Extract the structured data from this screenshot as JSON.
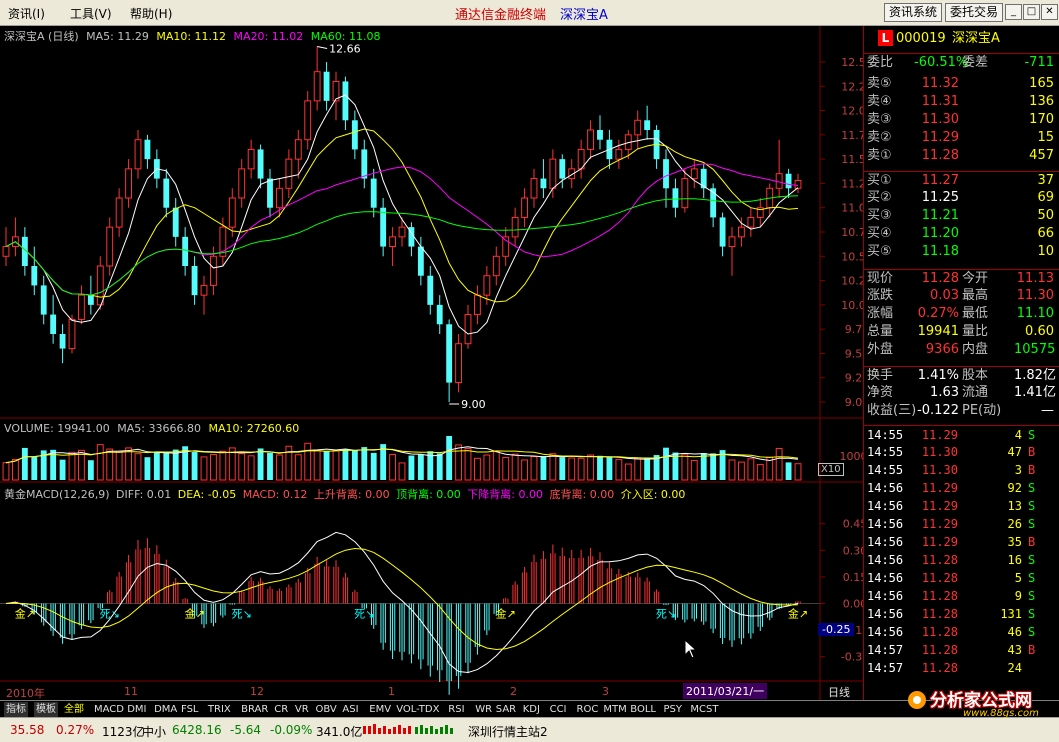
{
  "menubar": {
    "menu_info": "资讯(I)",
    "menu_tools": "工具(V)",
    "menu_help": "帮助(H)",
    "app_title": "通达信金融终端",
    "app_stock": "深深宝A",
    "btn_info_system": "资讯系统",
    "btn_trade": "委托交易"
  },
  "chart_data": [
    {
      "type": "candlestick",
      "title": "深深宝A (日线)",
      "indicators": [
        {
          "name": "MA5",
          "value": 11.29,
          "color": "#ffffff"
        },
        {
          "name": "MA10",
          "value": 11.12,
          "color": "#ffff00"
        },
        {
          "name": "MA20",
          "value": 11.02,
          "color": "#ff00ff"
        },
        {
          "name": "MA60",
          "value": 11.08,
          "color": "#00ff00"
        }
      ],
      "ylim": [
        9.0,
        12.5
      ],
      "yticks": [
        "12.50",
        "12.25",
        "12.00",
        "11.75",
        "11.50",
        "11.25",
        "11.00",
        "10.75",
        "10.50",
        "10.25",
        "10.00",
        "9.75",
        "9.50",
        "9.25",
        "9.00"
      ],
      "annotations": [
        {
          "label": "12.66"
        },
        {
          "label": "9.00"
        }
      ],
      "x_labels": [
        "2010年",
        "11",
        "12",
        "1",
        "2",
        "3"
      ],
      "date_label": "2011/03/21/一",
      "period": "日线",
      "ohlc": [
        [
          10.5,
          10.8,
          10.4,
          10.6
        ],
        [
          10.6,
          10.9,
          10.5,
          10.7
        ],
        [
          10.7,
          10.8,
          10.3,
          10.4
        ],
        [
          10.4,
          10.6,
          10.1,
          10.2
        ],
        [
          10.2,
          10.3,
          9.8,
          9.9
        ],
        [
          9.9,
          10.1,
          9.6,
          9.7
        ],
        [
          9.7,
          9.8,
          9.4,
          9.55
        ],
        [
          9.55,
          9.9,
          9.5,
          9.85
        ],
        [
          9.85,
          10.2,
          9.8,
          10.1
        ],
        [
          10.1,
          10.3,
          9.9,
          10.0
        ],
        [
          10.0,
          10.5,
          9.95,
          10.4
        ],
        [
          10.4,
          10.9,
          10.3,
          10.8
        ],
        [
          10.8,
          11.2,
          10.7,
          11.1
        ],
        [
          11.1,
          11.5,
          11.0,
          11.4
        ],
        [
          11.4,
          11.8,
          11.3,
          11.7
        ],
        [
          11.7,
          11.75,
          11.4,
          11.5
        ],
        [
          11.5,
          11.6,
          11.2,
          11.3
        ],
        [
          11.3,
          11.4,
          10.9,
          11.0
        ],
        [
          11.0,
          11.1,
          10.6,
          10.7
        ],
        [
          10.7,
          10.8,
          10.3,
          10.4
        ],
        [
          10.4,
          10.5,
          10.0,
          10.1
        ],
        [
          10.1,
          10.3,
          9.9,
          10.2
        ],
        [
          10.2,
          10.6,
          10.1,
          10.5
        ],
        [
          10.5,
          10.9,
          10.4,
          10.8
        ],
        [
          10.8,
          11.2,
          10.7,
          11.1
        ],
        [
          11.1,
          11.5,
          11.0,
          11.4
        ],
        [
          11.4,
          11.7,
          11.3,
          11.6
        ],
        [
          11.6,
          11.65,
          11.2,
          11.3
        ],
        [
          11.3,
          11.4,
          10.9,
          11.0
        ],
        [
          11.0,
          11.3,
          10.9,
          11.2
        ],
        [
          11.2,
          11.6,
          11.1,
          11.5
        ],
        [
          11.5,
          11.8,
          11.3,
          11.7
        ],
        [
          11.7,
          12.2,
          11.6,
          12.1
        ],
        [
          12.1,
          12.66,
          12.0,
          12.4
        ],
        [
          12.4,
          12.5,
          12.0,
          12.1
        ],
        [
          12.1,
          12.4,
          11.9,
          12.3
        ],
        [
          12.3,
          12.35,
          11.8,
          11.9
        ],
        [
          11.9,
          12.0,
          11.5,
          11.6
        ],
        [
          11.6,
          11.7,
          11.2,
          11.3
        ],
        [
          11.3,
          11.4,
          10.9,
          11.0
        ],
        [
          11.0,
          11.1,
          10.5,
          10.6
        ],
        [
          10.6,
          10.8,
          10.4,
          10.7
        ],
        [
          10.7,
          10.9,
          10.6,
          10.8
        ],
        [
          10.8,
          10.85,
          10.5,
          10.6
        ],
        [
          10.6,
          10.7,
          10.2,
          10.3
        ],
        [
          10.3,
          10.4,
          9.9,
          10.0
        ],
        [
          10.0,
          10.1,
          9.7,
          9.8
        ],
        [
          9.8,
          9.85,
          9.0,
          9.2
        ],
        [
          9.2,
          9.7,
          9.1,
          9.6
        ],
        [
          9.6,
          10.0,
          9.55,
          9.9
        ],
        [
          9.9,
          10.2,
          9.8,
          10.1
        ],
        [
          10.1,
          10.4,
          10.0,
          10.3
        ],
        [
          10.3,
          10.6,
          10.2,
          10.5
        ],
        [
          10.5,
          10.8,
          10.4,
          10.7
        ],
        [
          10.7,
          11.0,
          10.6,
          10.9
        ],
        [
          10.9,
          11.2,
          10.8,
          11.1
        ],
        [
          11.1,
          11.4,
          11.0,
          11.3
        ],
        [
          11.3,
          11.5,
          11.1,
          11.2
        ],
        [
          11.2,
          11.6,
          11.1,
          11.5
        ],
        [
          11.5,
          11.55,
          11.2,
          11.3
        ],
        [
          11.3,
          11.5,
          11.2,
          11.4
        ],
        [
          11.4,
          11.7,
          11.3,
          11.6
        ],
        [
          11.6,
          11.9,
          11.5,
          11.8
        ],
        [
          11.8,
          11.95,
          11.6,
          11.7
        ],
        [
          11.7,
          11.8,
          11.4,
          11.5
        ],
        [
          11.5,
          11.7,
          11.4,
          11.6
        ],
        [
          11.6,
          11.8,
          11.5,
          11.75
        ],
        [
          11.75,
          12.0,
          11.6,
          11.9
        ],
        [
          11.9,
          12.05,
          11.7,
          11.8
        ],
        [
          11.8,
          11.85,
          11.4,
          11.5
        ],
        [
          11.5,
          11.6,
          11.0,
          11.2
        ],
        [
          11.2,
          11.3,
          10.9,
          11.0
        ],
        [
          11.0,
          11.4,
          10.95,
          11.3
        ],
        [
          11.3,
          11.5,
          11.2,
          11.4
        ],
        [
          11.4,
          11.45,
          11.1,
          11.2
        ],
        [
          11.2,
          11.25,
          10.8,
          10.9
        ],
        [
          10.9,
          10.95,
          10.5,
          10.6
        ],
        [
          10.6,
          10.8,
          10.3,
          10.7
        ],
        [
          10.7,
          10.9,
          10.6,
          10.8
        ],
        [
          10.8,
          11.0,
          10.7,
          10.9
        ],
        [
          10.9,
          11.1,
          10.8,
          11.0
        ],
        [
          11.0,
          11.25,
          10.9,
          11.2
        ],
        [
          11.2,
          11.7,
          11.1,
          11.35
        ],
        [
          11.35,
          11.4,
          11.1,
          11.2
        ],
        [
          11.2,
          11.35,
          11.15,
          11.28
        ]
      ]
    },
    {
      "type": "bar",
      "title": "VOLUME",
      "indicators": [
        {
          "name": "VOLUME",
          "value": "19941.00",
          "color": "#c0c0c0"
        },
        {
          "name": "MA5",
          "value": "33666.80",
          "color": "#c0c0c0"
        },
        {
          "name": "MA10",
          "value": "27260.60",
          "color": "#ffff00"
        }
      ],
      "yticks": [
        "10000"
      ],
      "unit_label": "X10"
    },
    {
      "type": "bar",
      "title": "黄金MACD(12,26,9)",
      "indicators": [
        {
          "name": "DIFF",
          "value": "0.01",
          "color": "#c0c0c0"
        },
        {
          "name": "DEA",
          "value": "-0.05",
          "color": "#ffff00"
        },
        {
          "name": "MACD",
          "value": "0.12",
          "color": "#ff5050"
        },
        {
          "name": "上升背离",
          "value": "0.00",
          "color": "#ff5050"
        },
        {
          "name": "顶背离",
          "value": "0.00",
          "color": "#00ff00"
        },
        {
          "name": "下降背离",
          "value": "0.00",
          "color": "#ff00ff"
        },
        {
          "name": "底背离",
          "value": "0.00",
          "color": "#ff5050"
        },
        {
          "name": "介入区",
          "value": "0.00",
          "color": "#ffff00"
        }
      ],
      "yticks": [
        "0.45",
        "0.30",
        "0.15",
        "0.00",
        "-0.15",
        "-0.30"
      ],
      "ylim": [
        -0.42,
        0.55
      ],
      "current_value": "-0.25",
      "signals": [
        "金↗",
        "死↘",
        "金↗",
        "死↘",
        "死↘",
        "金↗",
        "死↘",
        "金↗"
      ]
    }
  ],
  "right_panel": {
    "stock_code": "000019",
    "stock_name": "深深宝A",
    "code_badge": "L",
    "weibi_label": "委比",
    "weibi_value": "-60.51%",
    "weicha_label": "委差",
    "weicha_value": "-711",
    "sell": [
      {
        "label": "卖⑤",
        "price": "11.32",
        "vol": "165"
      },
      {
        "label": "卖④",
        "price": "11.31",
        "vol": "136"
      },
      {
        "label": "卖③",
        "price": "11.30",
        "vol": "170"
      },
      {
        "label": "卖②",
        "price": "11.29",
        "vol": "15"
      },
      {
        "label": "卖①",
        "price": "11.28",
        "vol": "457"
      }
    ],
    "buy": [
      {
        "label": "买①",
        "price": "11.27",
        "vol": "37"
      },
      {
        "label": "买②",
        "price": "11.25",
        "vol": "69"
      },
      {
        "label": "买③",
        "price": "11.21",
        "vol": "50"
      },
      {
        "label": "买④",
        "price": "11.20",
        "vol": "66"
      },
      {
        "label": "买⑤",
        "price": "11.18",
        "vol": "10"
      }
    ],
    "stats": [
      {
        "l1": "现价",
        "v1": "11.28",
        "l2": "今开",
        "v2": "11.13"
      },
      {
        "l1": "涨跌",
        "v1": "0.03",
        "l2": "最高",
        "v2": "11.30"
      },
      {
        "l1": "涨幅",
        "v1": "0.27%",
        "l2": "最低",
        "v2": "11.10"
      },
      {
        "l1": "总量",
        "v1": "19941",
        "l2": "量比",
        "v2": "0.60"
      },
      {
        "l1": "外盘",
        "v1": "9366",
        "l2": "内盘",
        "v2": "10575"
      }
    ],
    "fund": [
      {
        "l1": "换手",
        "v1": "1.41%",
        "l2": "股本",
        "v2": "1.82亿"
      },
      {
        "l1": "净资",
        "v1": "1.63",
        "l2": "流通",
        "v2": "1.41亿"
      },
      {
        "l1": "收益(三)",
        "v1": "-0.122",
        "l2": "PE(动)",
        "v2": "—"
      }
    ],
    "ticks": [
      {
        "time": "14:55",
        "price": "11.29",
        "vol": "4",
        "side": "S"
      },
      {
        "time": "14:55",
        "price": "11.30",
        "vol": "47",
        "side": "B"
      },
      {
        "time": "14:55",
        "price": "11.30",
        "vol": "3",
        "side": "B"
      },
      {
        "time": "14:56",
        "price": "11.29",
        "vol": "92",
        "side": "S"
      },
      {
        "time": "14:56",
        "price": "11.29",
        "vol": "13",
        "side": "S"
      },
      {
        "time": "14:56",
        "price": "11.29",
        "vol": "26",
        "side": "S"
      },
      {
        "time": "14:56",
        "price": "11.29",
        "vol": "35",
        "side": "B"
      },
      {
        "time": "14:56",
        "price": "11.28",
        "vol": "16",
        "side": "S"
      },
      {
        "time": "14:56",
        "price": "11.28",
        "vol": "5",
        "side": "S"
      },
      {
        "time": "14:56",
        "price": "11.28",
        "vol": "9",
        "side": "S"
      },
      {
        "time": "14:56",
        "price": "11.28",
        "vol": "131",
        "side": "S"
      },
      {
        "time": "14:56",
        "price": "11.28",
        "vol": "46",
        "side": "S"
      },
      {
        "time": "14:57",
        "price": "11.28",
        "vol": "43",
        "side": "B"
      },
      {
        "time": "14:57",
        "price": "11.28",
        "vol": "24",
        "side": ""
      }
    ]
  },
  "tabs": [
    "指标",
    "模板",
    "全部",
    "MACD",
    "DMI",
    "DMA",
    "FSL",
    "TRIX",
    "BRAR",
    "CR",
    "VR",
    "OBV",
    "ASI",
    "EMV",
    "VOL-TDX",
    "RSI",
    "WR",
    "SAR",
    "KDJ",
    "CCI",
    "ROC",
    "MTM",
    "BOLL",
    "PSY",
    "MCST"
  ],
  "status": {
    "index1_val": "35.58",
    "index1_pct": "0.27%",
    "index1_amt": "1123亿",
    "index2_name": "中小",
    "index2_val": "6428.16",
    "index2_chg": "-5.64",
    "index2_pct": "-0.09%",
    "index2_amt": "341.0亿",
    "server": "深圳行情主站2"
  },
  "watermark": {
    "text": "分析家公式网",
    "url": "www.88gs.com"
  },
  "colors": {
    "up": "#ff3232",
    "down": "#54fcfc",
    "accent": "#ffff00",
    "ma20": "#ff00ff",
    "ma60": "#00c000",
    "grid": "#800000"
  }
}
